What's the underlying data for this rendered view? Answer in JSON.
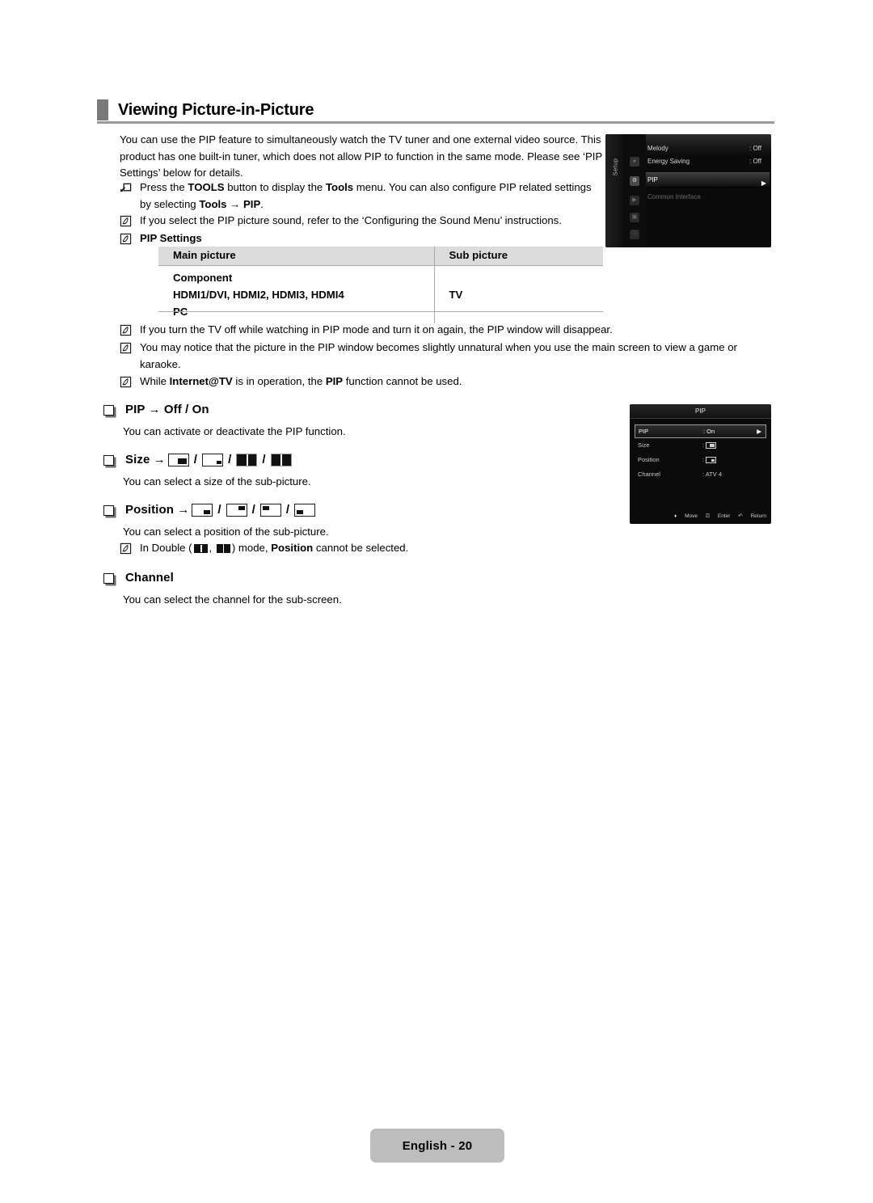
{
  "page": {
    "title": "Viewing Picture-in-Picture",
    "footer_label": "English - 20"
  },
  "intro": {
    "paragraph": "You can use the PIP feature to simultaneously watch the TV tuner and one external video source. This product has one built-in tuner, which does not allow PIP to function in the same mode. Please see ‘PIP Settings’ below for details."
  },
  "notes_top": [
    {
      "icon": "tools-shortcut-icon",
      "text_html": "Press the <b>TOOLS</b> button to display the <b>Tools</b> menu. You can also configure PIP related settings by selecting <b>Tools → PIP</b>."
    },
    {
      "icon": "note-icon",
      "text_html": "If you select the PIP picture sound, refer to the ‘Configuring the Sound Menu’ instructions."
    },
    {
      "icon": "note-icon",
      "text_html": "<b>PIP Settings</b>"
    }
  ],
  "table": {
    "headers": [
      "Main picture",
      "Sub picture"
    ],
    "main_rows": [
      "Component",
      "HDMI1/DVI, HDMI2, HDMI3, HDMI4",
      "PC"
    ],
    "sub_value": "TV"
  },
  "notes_bottom": [
    {
      "icon": "note-icon",
      "text_html": "If you turn the TV off while watching in PIP mode and turn it on again, the PIP window will disappear."
    },
    {
      "icon": "note-icon",
      "text_html": "You may notice that the picture in the PIP window becomes slightly unnatural when you use the main screen to view a game or karaoke."
    },
    {
      "icon": "note-icon",
      "text_html": "While <b>Internet@TV</b> is in operation, the <b>PIP</b> function cannot be used."
    }
  ],
  "sections": {
    "pip": {
      "heading": "PIP → Off / On",
      "description": "You can activate or deactivate the PIP function."
    },
    "size": {
      "heading_prefix": "Size →",
      "icons": [
        "size-large-sub",
        "size-small-sub",
        "double-split",
        "double-wide"
      ],
      "description": "You can select a size of the sub-picture."
    },
    "position": {
      "heading_prefix": "Position →",
      "icons": [
        "pos-bottom-right",
        "pos-top-right",
        "pos-top-left",
        "pos-bottom-left"
      ],
      "description": "You can select a position of the sub-picture.",
      "note_html": "In Double (<!--icons-->) mode, <b>Position</b> cannot be selected."
    },
    "channel": {
      "heading": "Channel",
      "description": "You can select the channel for the sub-screen."
    }
  },
  "tv_setup_menu": {
    "side_label": "Setup",
    "rows": [
      {
        "label": "Melody",
        "value": ": Off",
        "selected": false
      },
      {
        "label": "Energy Saving",
        "value": ": Off",
        "selected": false
      },
      {
        "label": "PIP",
        "value": "",
        "selected": true
      },
      {
        "label": "Common Interface",
        "value": "",
        "selected": false
      }
    ],
    "caret": "▶"
  },
  "pip_submenu": {
    "title": "PIP",
    "rows": [
      {
        "label": "PIP",
        "value": ": On",
        "selected": true,
        "icon": ""
      },
      {
        "label": "Size",
        "value": ":",
        "selected": false,
        "icon": "size-icon"
      },
      {
        "label": "Position",
        "value": ":",
        "selected": false,
        "icon": "position-icon"
      },
      {
        "label": "Channel",
        "value": ": ATV 4",
        "selected": false,
        "icon": ""
      }
    ],
    "caret": "▶",
    "footer": {
      "move": "Move",
      "enter": "Enter",
      "return": "Return"
    }
  }
}
